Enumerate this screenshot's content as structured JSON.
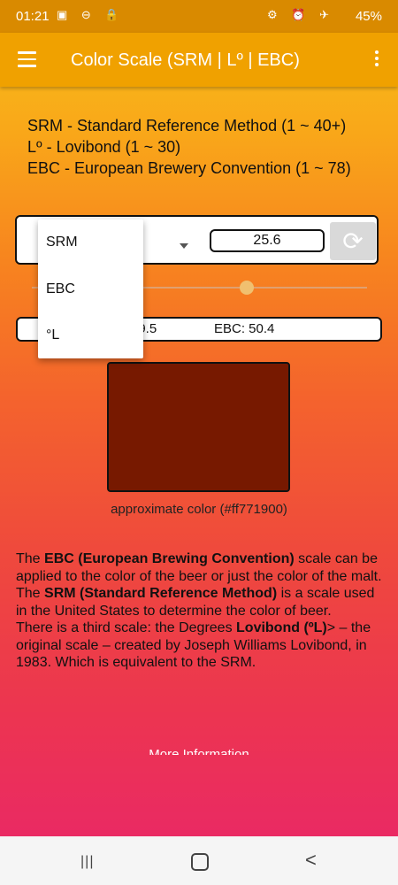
{
  "status_bar": {
    "time": "01:21",
    "left_icons": "▣ ⊖ 🔒",
    "right_icons": "⚙ ⏰ ✈",
    "battery": "45%"
  },
  "app_bar": {
    "title": "Color Scale (SRM | Lº | EBC)",
    "menu_icon": "hamburger-icon",
    "more_icon": "more-vert-icon"
  },
  "definitions": [
    "SRM - Standard Reference Method (1 ~ 40+)",
    "Lº - Lovibond (1 ~ 30)",
    "EBC - European Brewery Convention (1 ~ 78)"
  ],
  "converter": {
    "input_value": "25.6",
    "refresh_icon": "refresh-icon",
    "slider_fraction": 0.64,
    "dropdown_options": [
      "SRM",
      "EBC",
      "°L"
    ],
    "results_lovibond": "19.5",
    "results_ebc": "EBC: 50.4"
  },
  "swatch": {
    "color": "#771900",
    "caption": "approximate color (#ff771900)"
  },
  "info": {
    "p1_pre": "The ",
    "p1_bold": "EBC (European Brewing Convention)",
    "p1_post": " scale can be applied to the color of the beer or just the color of the malt.",
    "p2_pre": "The ",
    "p2_bold": "SRM (Standard Reference Method)",
    "p2_post": " is a scale used in the United States to determine the color of beer.",
    "p3_pre": "There is a third scale: the Degrees ",
    "p3_bold": "Lovibond (ºL)",
    "p3_post": "> – the original scale – created by Joseph Williams Lovibond, in 1983. Which is equivalent to the SRM."
  },
  "more_info": "More Information",
  "nav_bar": {
    "recent": "|||",
    "back": "<"
  }
}
